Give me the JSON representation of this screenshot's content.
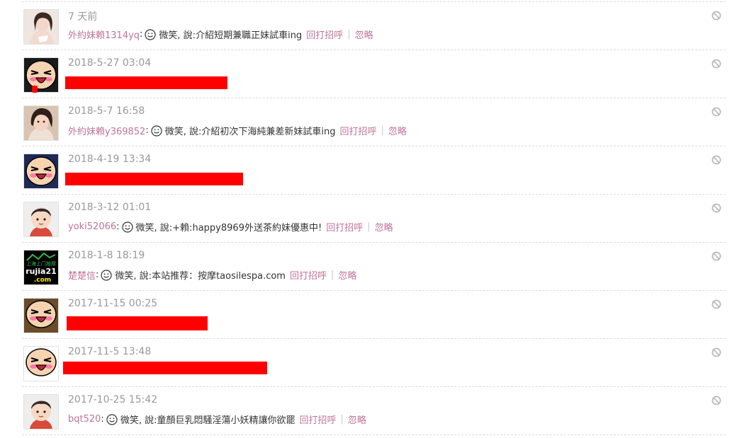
{
  "colors": {
    "accent": "#c0739a",
    "muted": "#999999",
    "text": "#333333",
    "redaction": "#ff0000"
  },
  "common": {
    "smile_icon": "smile-icon",
    "ignore_icon": "block-icon"
  },
  "feed": [
    {
      "time": "7 天前",
      "avatar": "photo-girl",
      "username": "外約妹賴1314yq",
      "sep_colon": ":",
      "mood": "微笑, 說:",
      "text": "介紹短期兼職正妹試車ing",
      "reply": "回打招呼",
      "divider": "|",
      "ignore": "忽略",
      "redacted": false
    },
    {
      "time": "2018-5-27 03:04",
      "avatar": "cartoon-laugh",
      "redacted": true
    },
    {
      "time": "2018-5-7 16:58",
      "avatar": "photo-girl-2",
      "username": "外約妹賴y369852",
      "sep_colon": ":",
      "mood": "微笑, 說:",
      "text": "介紹初次下海純兼差新妹試車ing",
      "reply": "回打招呼",
      "divider": "|",
      "ignore": "忽略",
      "redacted": false
    },
    {
      "time": "2018-4-19 13:34",
      "avatar": "cartoon-laugh",
      "redacted": true
    },
    {
      "time": "2018-3-12 01:01",
      "avatar": "cartoon-boy",
      "username": "yoki52066",
      "sep_colon": ":",
      "mood": "微笑, 說:",
      "text": "+賴:happy8969外送茶約妹優惠中!",
      "reply": "回打招呼",
      "divider": "|",
      "ignore": "忽略",
      "redacted": false
    },
    {
      "time": "2018-1-8 18:19",
      "avatar": "rujia-logo",
      "avatar_text_top": "上海上门按摩",
      "avatar_text_mid": "rujia21",
      "avatar_text_bot": ".com",
      "username": "楚楚信",
      "sep_colon": ":",
      "mood": "微笑, 說:",
      "text": "本站推荐：按摩taosilespa.com",
      "reply": "回打招呼",
      "divider": "|",
      "ignore": "忽略",
      "redacted": false
    },
    {
      "time": "2017-11-15 00:25",
      "avatar": "cartoon-laugh",
      "redacted": true
    },
    {
      "time": "2017-11-5 13:48",
      "avatar": "cartoon-laugh",
      "redacted": true
    },
    {
      "time": "2017-10-25 15:42",
      "avatar": "cartoon-boy",
      "username": "bqt520",
      "sep_colon": ":",
      "mood": "微笑, 說:",
      "text": "童顏巨乳悶騷淫蕩小妖精讓你欲罷",
      "reply": "回打招呼",
      "divider": "|",
      "ignore": "忽略",
      "redacted": false
    }
  ]
}
